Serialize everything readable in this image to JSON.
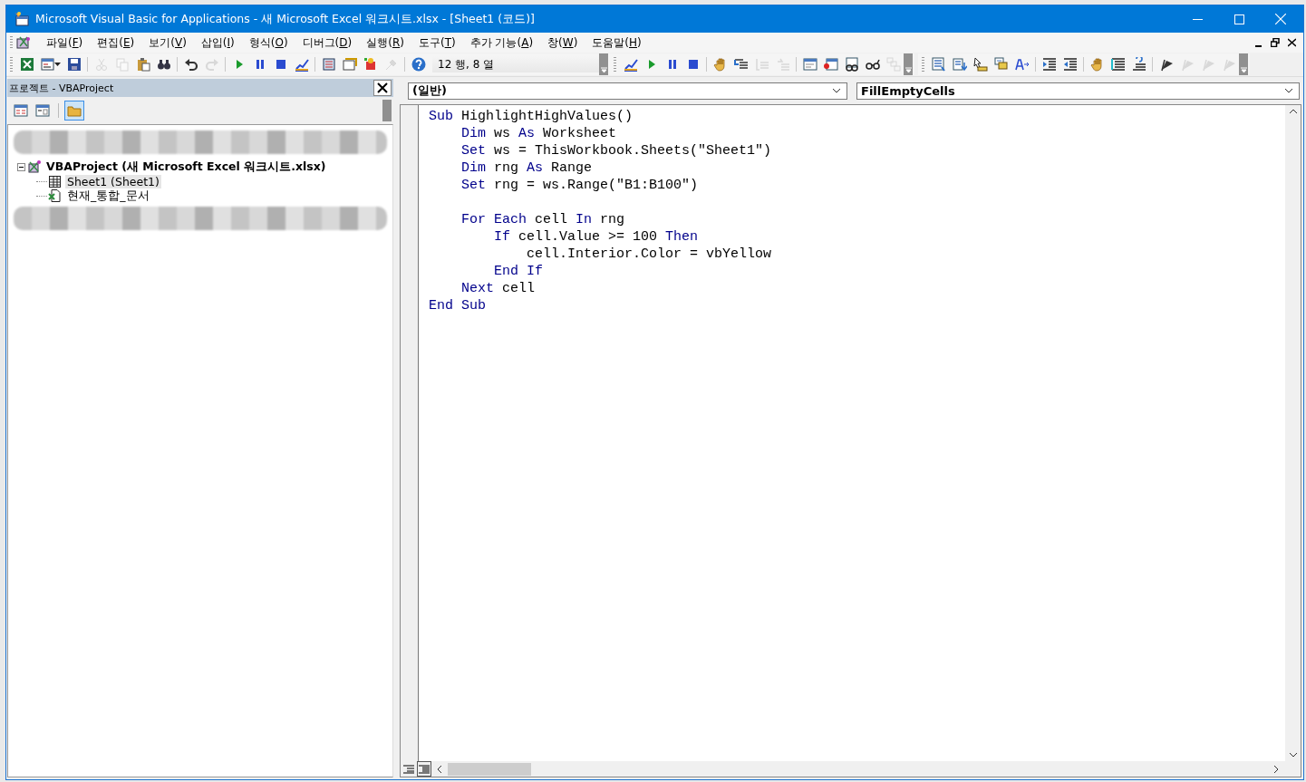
{
  "window": {
    "title": "Microsoft Visual Basic for Applications - 새 Microsoft Excel 워크시트.xlsx - [Sheet1 (코드)]"
  },
  "menu": [
    "파일(F)",
    "편집(E)",
    "보기(V)",
    "삽입(I)",
    "형식(O)",
    "디버그(D)",
    "실행(R)",
    "도구(T)",
    "추가 기능(A)",
    "창(W)",
    "도움말(H)"
  ],
  "toolbar_standard": [
    {
      "kind": "excel",
      "disabled": false
    },
    {
      "kind": "insert-form",
      "disabled": false
    },
    {
      "kind": "save",
      "disabled": false
    },
    {
      "kind": "sep"
    },
    {
      "kind": "cut",
      "disabled": true
    },
    {
      "kind": "copy",
      "disabled": true
    },
    {
      "kind": "paste",
      "disabled": false
    },
    {
      "kind": "find",
      "disabled": false
    },
    {
      "kind": "sep"
    },
    {
      "kind": "undo",
      "disabled": false
    },
    {
      "kind": "redo",
      "disabled": true
    },
    {
      "kind": "sep"
    },
    {
      "kind": "run",
      "disabled": false
    },
    {
      "kind": "pause",
      "disabled": false
    },
    {
      "kind": "stop",
      "disabled": false
    },
    {
      "kind": "design",
      "disabled": false
    },
    {
      "kind": "sep"
    },
    {
      "kind": "explorer",
      "disabled": false
    },
    {
      "kind": "properties",
      "disabled": false
    },
    {
      "kind": "browser",
      "disabled": false
    },
    {
      "kind": "toolbox",
      "disabled": true
    },
    {
      "kind": "sep"
    },
    {
      "kind": "help",
      "disabled": false
    }
  ],
  "position": "12 행, 8 열",
  "toolbar_debug": [
    {
      "kind": "design",
      "disabled": false
    },
    {
      "kind": "run",
      "disabled": false
    },
    {
      "kind": "pause",
      "disabled": false
    },
    {
      "kind": "stop",
      "disabled": false
    },
    {
      "kind": "sep"
    },
    {
      "kind": "hand",
      "disabled": false
    },
    {
      "kind": "step-into",
      "disabled": false
    },
    {
      "kind": "step-over",
      "disabled": true
    },
    {
      "kind": "step-out",
      "disabled": true
    },
    {
      "kind": "sep"
    },
    {
      "kind": "window",
      "disabled": false
    },
    {
      "kind": "window-alert",
      "disabled": false
    },
    {
      "kind": "watch",
      "disabled": false
    },
    {
      "kind": "glasses",
      "disabled": false
    },
    {
      "kind": "stack",
      "disabled": true
    }
  ],
  "toolbar_edit": [
    {
      "kind": "list",
      "disabled": false
    },
    {
      "kind": "list-down",
      "disabled": false
    },
    {
      "kind": "quick-info",
      "disabled": false
    },
    {
      "kind": "param",
      "disabled": false
    },
    {
      "kind": "complete",
      "disabled": false
    },
    {
      "kind": "sep"
    },
    {
      "kind": "indent",
      "disabled": false
    },
    {
      "kind": "outdent",
      "disabled": false
    },
    {
      "kind": "sep"
    },
    {
      "kind": "hand",
      "disabled": false
    },
    {
      "kind": "comment",
      "disabled": false
    },
    {
      "kind": "uncomment",
      "disabled": false
    },
    {
      "kind": "sep"
    },
    {
      "kind": "bookmark",
      "disabled": false
    },
    {
      "kind": "bookmark",
      "disabled": true
    },
    {
      "kind": "bookmark",
      "disabled": true
    },
    {
      "kind": "bookmark",
      "disabled": true
    }
  ],
  "project": {
    "title": "프로젝트 - VBAProject",
    "view_buttons": [
      {
        "kind": "code",
        "selected": false
      },
      {
        "kind": "object",
        "selected": false
      },
      {
        "kind": "folders",
        "selected": true
      }
    ],
    "tree": [
      {
        "label": "VBAProject (새 Microsoft Excel 워크시트.xlsx)",
        "kind": "project",
        "expanded": true,
        "selected": false,
        "children": [
          {
            "label": "Sheet1 (Sheet1)",
            "kind": "sheet",
            "selected": true
          },
          {
            "label": "현재_통합_문서",
            "kind": "workbook",
            "selected": false
          }
        ]
      }
    ]
  },
  "code": {
    "object": "(일반)",
    "procedure": "FillEmptyCells",
    "lines": [
      {
        "tokens": [
          {
            "kind": "keyword",
            "text": "Sub"
          },
          {
            "kind": "plain",
            "text": " HighlightHighValues()"
          }
        ]
      },
      {
        "tokens": [
          {
            "kind": "keyword",
            "text": "    Dim"
          },
          {
            "kind": "plain",
            "text": " ws "
          },
          {
            "kind": "keyword",
            "text": "As"
          },
          {
            "kind": "plain",
            "text": " Worksheet"
          }
        ]
      },
      {
        "tokens": [
          {
            "kind": "keyword",
            "text": "    Set"
          },
          {
            "kind": "plain",
            "text": " ws = ThisWorkbook.Sheets(\"Sheet1\")"
          }
        ]
      },
      {
        "tokens": [
          {
            "kind": "keyword",
            "text": "    Dim"
          },
          {
            "kind": "plain",
            "text": " rng "
          },
          {
            "kind": "keyword",
            "text": "As"
          },
          {
            "kind": "plain",
            "text": " Range"
          }
        ]
      },
      {
        "tokens": [
          {
            "kind": "keyword",
            "text": "    Set"
          },
          {
            "kind": "plain",
            "text": " rng = ws.Range(\"B1:B100\")"
          }
        ]
      },
      {
        "blank_before": true,
        "tokens": [
          {
            "kind": "keyword",
            "text": "    For Each"
          },
          {
            "kind": "plain",
            "text": " cell "
          },
          {
            "kind": "keyword",
            "text": "In"
          },
          {
            "kind": "plain",
            "text": " rng"
          }
        ]
      },
      {
        "tokens": [
          {
            "kind": "keyword",
            "text": "        If"
          },
          {
            "kind": "plain",
            "text": " cell.Value >= 100 "
          },
          {
            "kind": "keyword",
            "text": "Then"
          }
        ]
      },
      {
        "tokens": [
          {
            "kind": "plain",
            "text": "            cell.Interior.Color = vbYellow"
          }
        ]
      },
      {
        "tokens": [
          {
            "kind": "keyword",
            "text": "        End If"
          }
        ]
      },
      {
        "tokens": [
          {
            "kind": "keyword",
            "text": "    Next"
          },
          {
            "kind": "plain",
            "text": " cell"
          }
        ]
      },
      {
        "tokens": [
          {
            "kind": "keyword",
            "text": "End Sub"
          }
        ]
      }
    ]
  }
}
